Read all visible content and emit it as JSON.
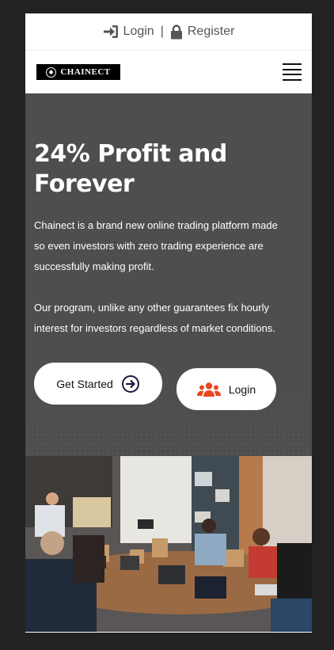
{
  "topbar": {
    "login_label": "Login",
    "separator": "|",
    "register_label": "Register"
  },
  "navbar": {
    "logo_text": "CHAINECT"
  },
  "hero": {
    "title": "24% Profit and Forever",
    "paragraph1": "Chainect is a brand new online trading platform made so even investors with zero trading experience are successfully making profit.",
    "paragraph2": "Our program, unlike any other guarantees fix hourly interest for investors regardless of market conditions.",
    "get_started_label": "Get Started",
    "login_label": "Login"
  },
  "colors": {
    "hero_bg": "#4e4e4e",
    "accent": "#e8471f",
    "frame_bg": "#222222"
  }
}
